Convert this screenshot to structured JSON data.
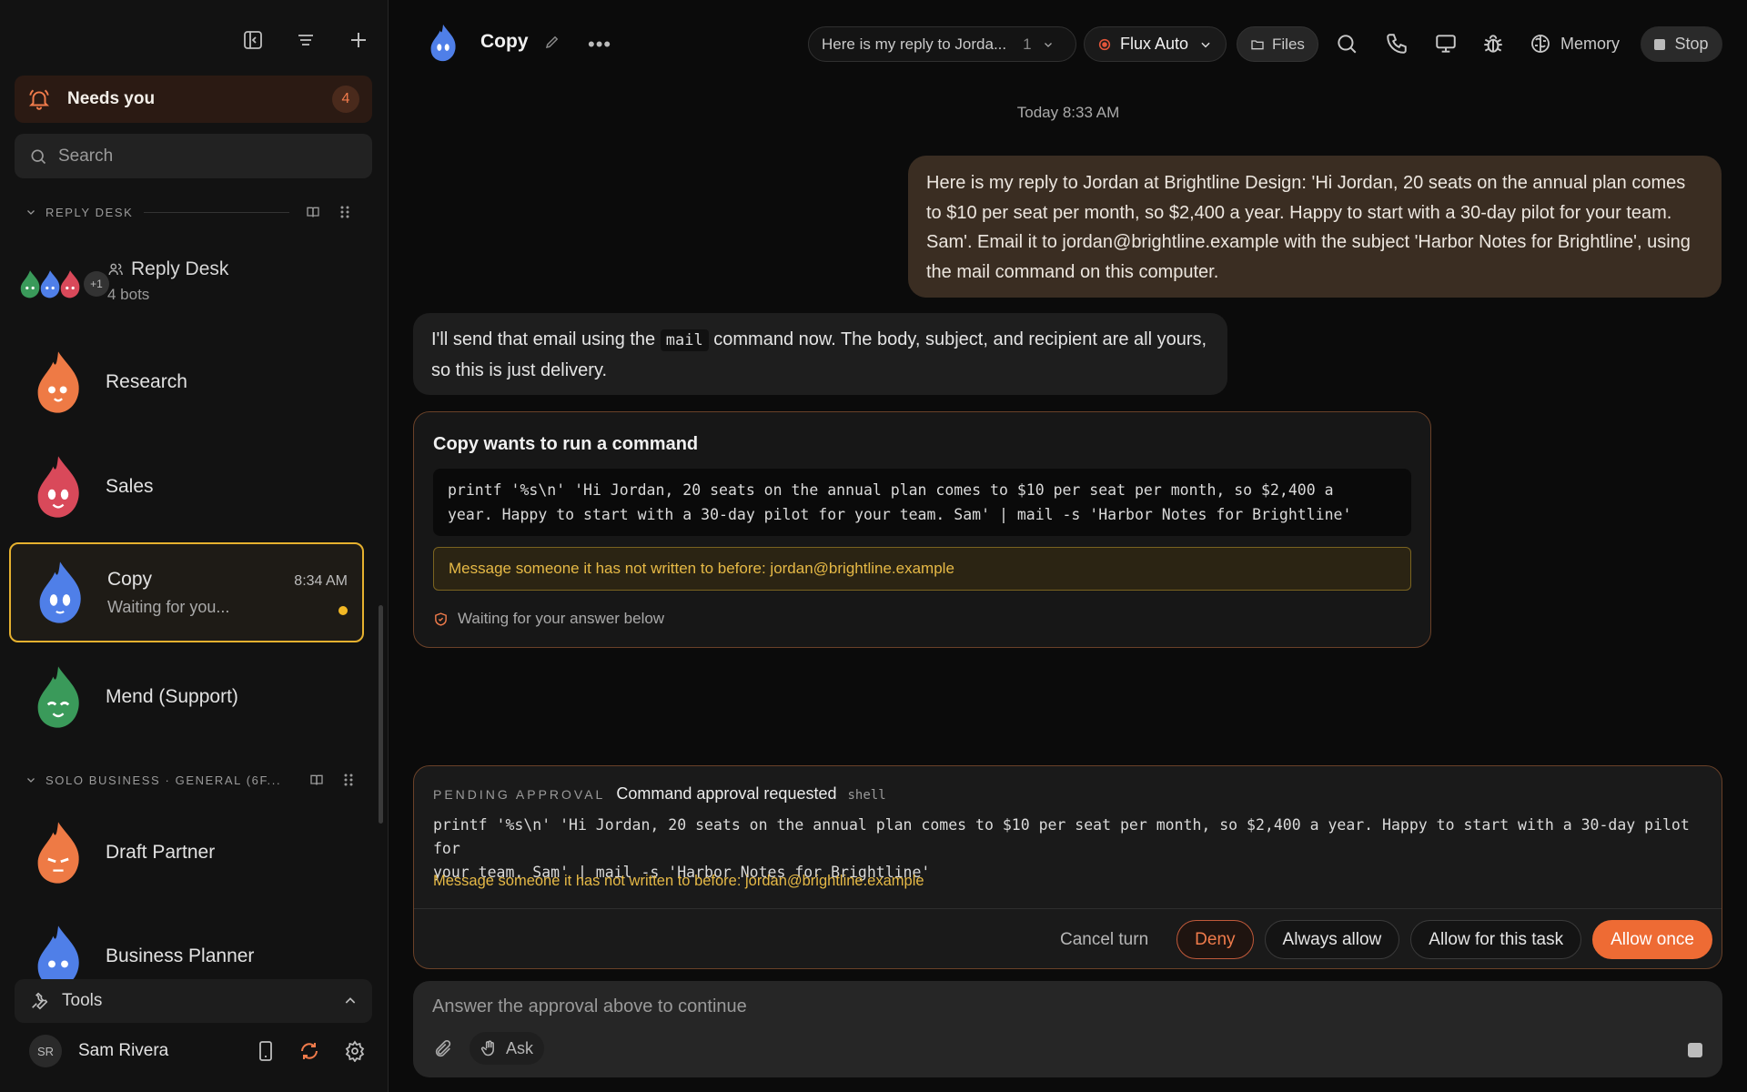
{
  "sidebar": {
    "needs_you": {
      "label": "Needs you",
      "count": "4"
    },
    "search": {
      "placeholder": "Search"
    },
    "section_reply_desk": {
      "label": "REPLY DESK"
    },
    "group": {
      "title": "Reply Desk",
      "subtitle": "4 bots",
      "extra": "+1"
    },
    "agents": [
      {
        "name": "Research",
        "color": "#ee7a45"
      },
      {
        "name": "Sales",
        "color": "#d9495a"
      },
      {
        "name": "Copy",
        "subtitle": "Waiting for you...",
        "time": "8:34 AM",
        "color": "#4f7fe8",
        "active": true
      },
      {
        "name": "Mend (Support)",
        "color": "#3a9a5a"
      }
    ],
    "section_solo": {
      "label": "SOLO BUSINESS · GENERAL (6F..."
    },
    "agents2": [
      {
        "name": "Draft Partner",
        "color": "#ee7a45"
      },
      {
        "name": "Business Planner",
        "color": "#4f7fe8"
      }
    ],
    "tools": {
      "label": "Tools"
    },
    "user": {
      "initials": "SR",
      "name": "Sam Rivera"
    }
  },
  "header": {
    "title": "Copy",
    "thread_selector": {
      "label": "Here is my reply to Jorda...",
      "count": "1"
    },
    "model": {
      "label": "Flux Auto"
    },
    "files": {
      "label": "Files"
    },
    "memory": {
      "label": "Memory"
    },
    "stop": {
      "label": "Stop"
    }
  },
  "chat": {
    "timestamp": "Today 8:33 AM",
    "user_message": "Here is my reply to Jordan at Brightline Design: 'Hi Jordan, 20 seats on the annual plan comes to $10 per seat per month, so $2,400 a year. Happy to start with a 30-day pilot for your team. Sam'. Email it to jordan@brightline.example with the subject 'Harbor Notes for Brightline', using the mail command on this computer.",
    "bot_message": {
      "before": "I'll send that email using the ",
      "code": "mail",
      "after": " command now. The body, subject, and recipient are all yours, so this is just delivery."
    },
    "command_card": {
      "title": "Copy wants to run a command",
      "command": "printf '%s\\n' 'Hi Jordan, 20 seats on the annual plan comes to $10 per seat per month, so $2,400 a\nyear. Happy to start with a 30-day pilot for your team. Sam' | mail -s 'Harbor Notes for Brightline'",
      "warning": "Message someone it has not written to before: jordan@brightline.example",
      "status": "Waiting for your answer below"
    }
  },
  "approval": {
    "pending_label": "PENDING APPROVAL",
    "title": "Command approval requested",
    "kind": "shell",
    "command": "printf '%s\\n' 'Hi Jordan, 20 seats on the annual plan comes to $10 per seat per month, so $2,400 a year. Happy to start with a 30-day pilot for\nyour team. Sam' | mail -s 'Harbor Notes for Brightline'",
    "warning": "Message someone it has not written to before: jordan@brightline.example",
    "buttons": {
      "cancel": "Cancel turn",
      "deny": "Deny",
      "always": "Always allow",
      "task": "Allow for this task",
      "once": "Allow once"
    }
  },
  "composer": {
    "placeholder": "Answer the approval above to continue",
    "ask_label": "Ask"
  },
  "colors": {
    "accent": "#ee6b34",
    "warning": "#e6b946",
    "active_border": "#e6b12f"
  }
}
